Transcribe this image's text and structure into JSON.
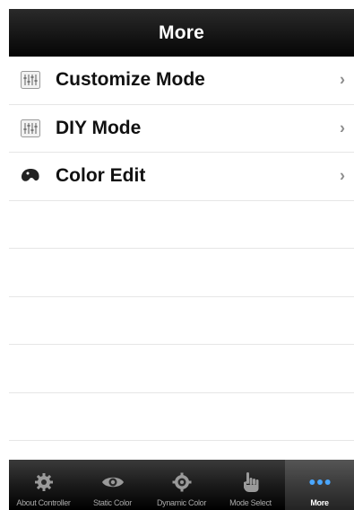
{
  "navbar": {
    "title": "More"
  },
  "list": {
    "items": [
      {
        "label": "Customize Mode",
        "icon": "sliders-icon"
      },
      {
        "label": "DIY Mode",
        "icon": "sliders-icon"
      },
      {
        "label": "Color Edit",
        "icon": "palette-icon"
      }
    ]
  },
  "tabbar": {
    "tabs": [
      {
        "label": "About Controller",
        "icon": "gear-icon"
      },
      {
        "label": "Static Color",
        "icon": "eye-icon"
      },
      {
        "label": "Dynamic Color",
        "icon": "gear-icon"
      },
      {
        "label": "Mode Select",
        "icon": "hand-icon"
      },
      {
        "label": "More",
        "icon": "more-dots-icon",
        "active": true
      }
    ]
  },
  "colors": {
    "navbar_bg": "#000000",
    "tabbar_bg": "#1b1b1b",
    "active_tab_icon": "#4aa7ff",
    "chevron": "#8e8e8e"
  }
}
